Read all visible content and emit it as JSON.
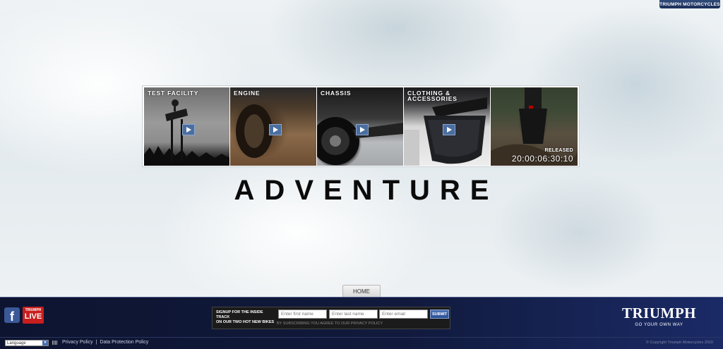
{
  "header": {
    "brand_tab": "TRIUMPH MOTORCYCLES"
  },
  "videos": [
    {
      "label": "TEST FACILITY",
      "play_icon": "play-icon"
    },
    {
      "label": "ENGINE",
      "play_icon": "play-icon"
    },
    {
      "label": "CHASSIS",
      "play_icon": "play-icon"
    },
    {
      "label": "CLOTHING & ACCESSORIES",
      "play_icon": "play-icon"
    },
    {
      "label": "",
      "released_label": "RELEASED",
      "countdown": "20:00:06:30:10"
    }
  ],
  "hero": {
    "title": "ADVENTURE"
  },
  "nav": {
    "home": "HOME"
  },
  "footer": {
    "live_top": "TRIUMPH",
    "live_label": "LIVE",
    "signup": {
      "line1": "SIGNUP FOR THE INSIDE TRACK",
      "line2": "ON OUR TWO HOT NEW BIKES",
      "first_name_placeholder": "Enter first name",
      "last_name_placeholder": "Enter last name",
      "email_placeholder": "Enter email",
      "submit": "SUBMIT",
      "disclaimer": "BY SUBSCRIBING YOU AGREE TO OUR PRIVACY POLICY"
    },
    "logo_text": "TRIUMPH",
    "logo_slogan": "GO YOUR OWN WAY",
    "language": "Language",
    "privacy": "Privacy Policy",
    "data_protection": "Data Protection Policy",
    "copyright": "© Copyright Triumph Motorcycles 2010"
  },
  "colors": {
    "footer_bg": "#111a3c",
    "accent": "#4a6ea0",
    "live_red": "#c81e1e",
    "facebook": "#3b5998"
  }
}
